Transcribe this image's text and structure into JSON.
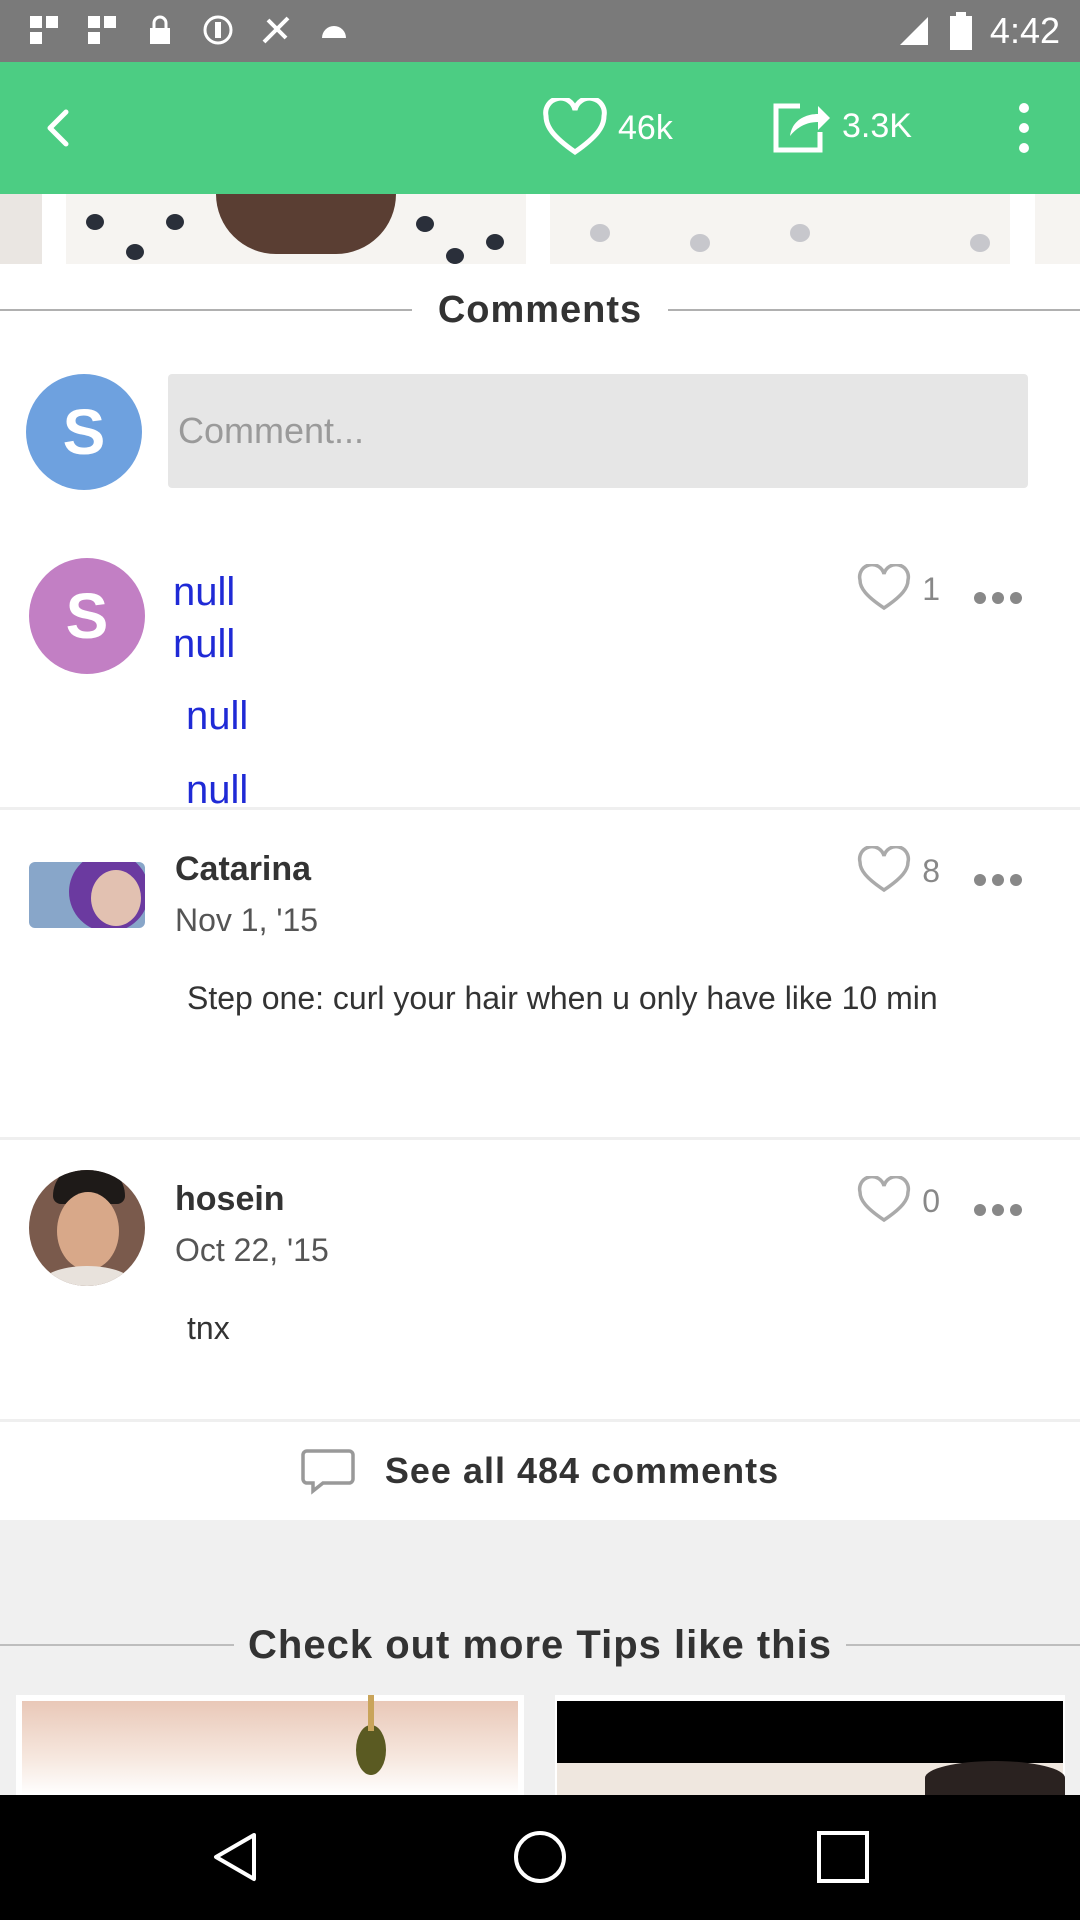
{
  "status_bar": {
    "time": "4:42"
  },
  "app_bar": {
    "likes": "46k",
    "shares": "3.3K"
  },
  "comments_section": {
    "title": "Comments",
    "input_placeholder": "Comment...",
    "user_initial": "S"
  },
  "comments": [
    {
      "avatar_initial": "S",
      "name": "null",
      "date": "null",
      "text_line1": "null",
      "text_line2": "null",
      "likes": "1"
    },
    {
      "name": "Catarina",
      "date": "Nov 1, '15",
      "text": "Step one: curl your hair when u only have like 10 min",
      "likes": "8"
    },
    {
      "name": "hosein",
      "date": "Oct 22, '15",
      "text": "tnx",
      "likes": "0"
    }
  ],
  "see_all": {
    "label": "See all 484 comments"
  },
  "more_tips": {
    "title": "Check out more Tips like this"
  },
  "colors": {
    "brand_green": "#4ccd83",
    "avatar_blue": "#6ea1df",
    "avatar_purple": "#c27fc4",
    "null_text": "#1f2ad6"
  },
  "icons": [
    "back-arrow-icon",
    "heart-icon",
    "share-icon",
    "overflow-menu-icon",
    "comment-bubble-icon",
    "nav-back-icon",
    "nav-home-icon",
    "nav-recents-icon"
  ]
}
